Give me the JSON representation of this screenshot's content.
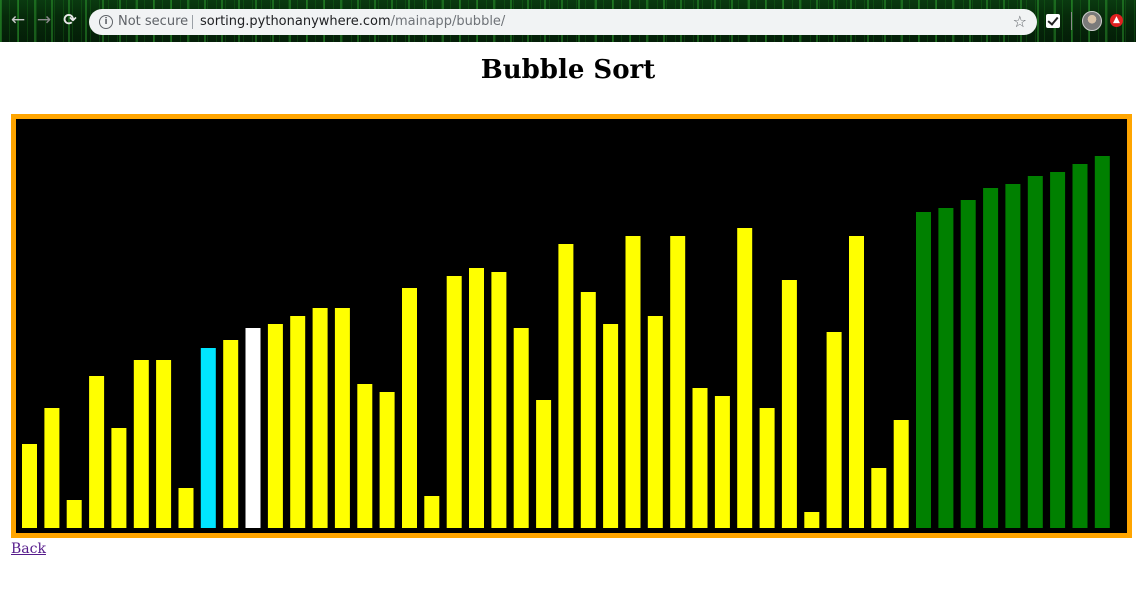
{
  "browser": {
    "security_label": "Not secure",
    "url_host": "sorting.pythonanywhere.com",
    "url_path": "/mainapp/bubble/"
  },
  "page": {
    "title": "Bubble Sort",
    "back_link": "Back"
  },
  "colors": {
    "frame": "#ffa500",
    "background": "#000000",
    "unsorted": "#ffff00",
    "compare_a": "#00e5ff",
    "compare_b": "#ffffff",
    "sorted": "#008000"
  },
  "chart_data": {
    "type": "bar",
    "values": [
      21,
      30,
      7,
      38,
      25,
      42,
      42,
      10,
      45,
      47,
      50,
      51,
      53,
      55,
      55,
      36,
      34,
      60,
      8,
      63,
      65,
      64,
      50,
      32,
      71,
      59,
      51,
      73,
      53,
      73,
      35,
      33,
      75,
      30,
      62,
      4,
      49,
      73,
      15,
      27,
      79,
      80,
      82,
      85,
      86,
      88,
      89,
      91,
      93
    ],
    "states": [
      "u",
      "u",
      "u",
      "u",
      "u",
      "u",
      "u",
      "u",
      "a",
      "u",
      "b",
      "u",
      "u",
      "u",
      "u",
      "u",
      "u",
      "u",
      "u",
      "u",
      "u",
      "u",
      "u",
      "u",
      "u",
      "u",
      "u",
      "u",
      "u",
      "u",
      "u",
      "u",
      "u",
      "u",
      "u",
      "u",
      "u",
      "u",
      "u",
      "u",
      "s",
      "s",
      "s",
      "s",
      "s",
      "s",
      "s",
      "s",
      "s"
    ],
    "ylim": [
      0,
      100
    ],
    "grid": false
  }
}
